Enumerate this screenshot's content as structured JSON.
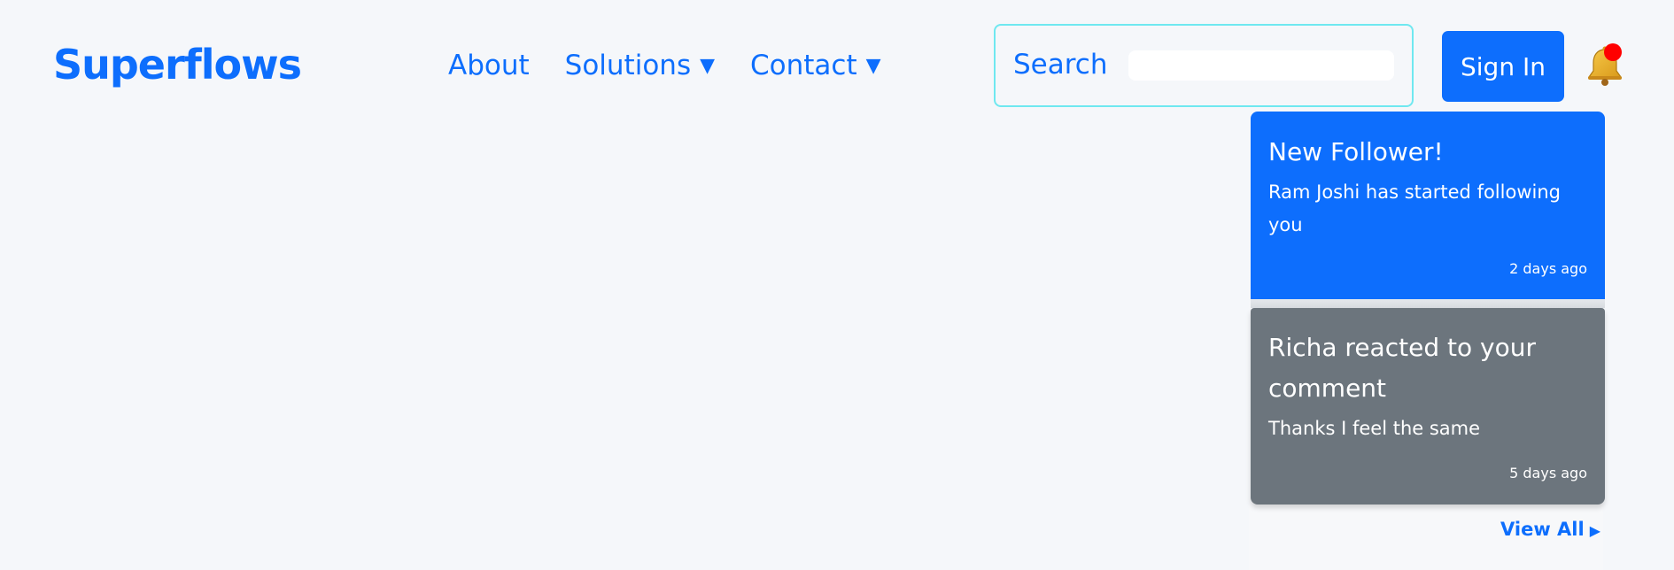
{
  "navbar": {
    "brand": "Superflows",
    "links": [
      {
        "label": "About",
        "has_dropdown": false
      },
      {
        "label": "Solutions",
        "has_dropdown": true
      },
      {
        "label": "Contact",
        "has_dropdown": true
      }
    ],
    "caret": "▼",
    "search": {
      "label": "Search",
      "value": "",
      "placeholder": ""
    },
    "signin_label": "Sign In",
    "bell_icon": "bell-icon",
    "has_unread": true
  },
  "notifications": {
    "items": [
      {
        "title": "New Follower!",
        "body": "Ram Joshi has started following you",
        "time": "2 days ago",
        "color": "#0d6efd"
      },
      {
        "title": "Richa reacted to your comment",
        "body": "Thanks I feel the same",
        "time": "5 days ago",
        "color": "#6c757d"
      }
    ],
    "view_all_label": "View All",
    "view_all_arrow": "▶"
  },
  "colors": {
    "primary": "#0d6efd",
    "secondary": "#6c757d",
    "background": "#f5f7fa",
    "search_border": "#6fe8f0",
    "badge": "#ff0000"
  }
}
